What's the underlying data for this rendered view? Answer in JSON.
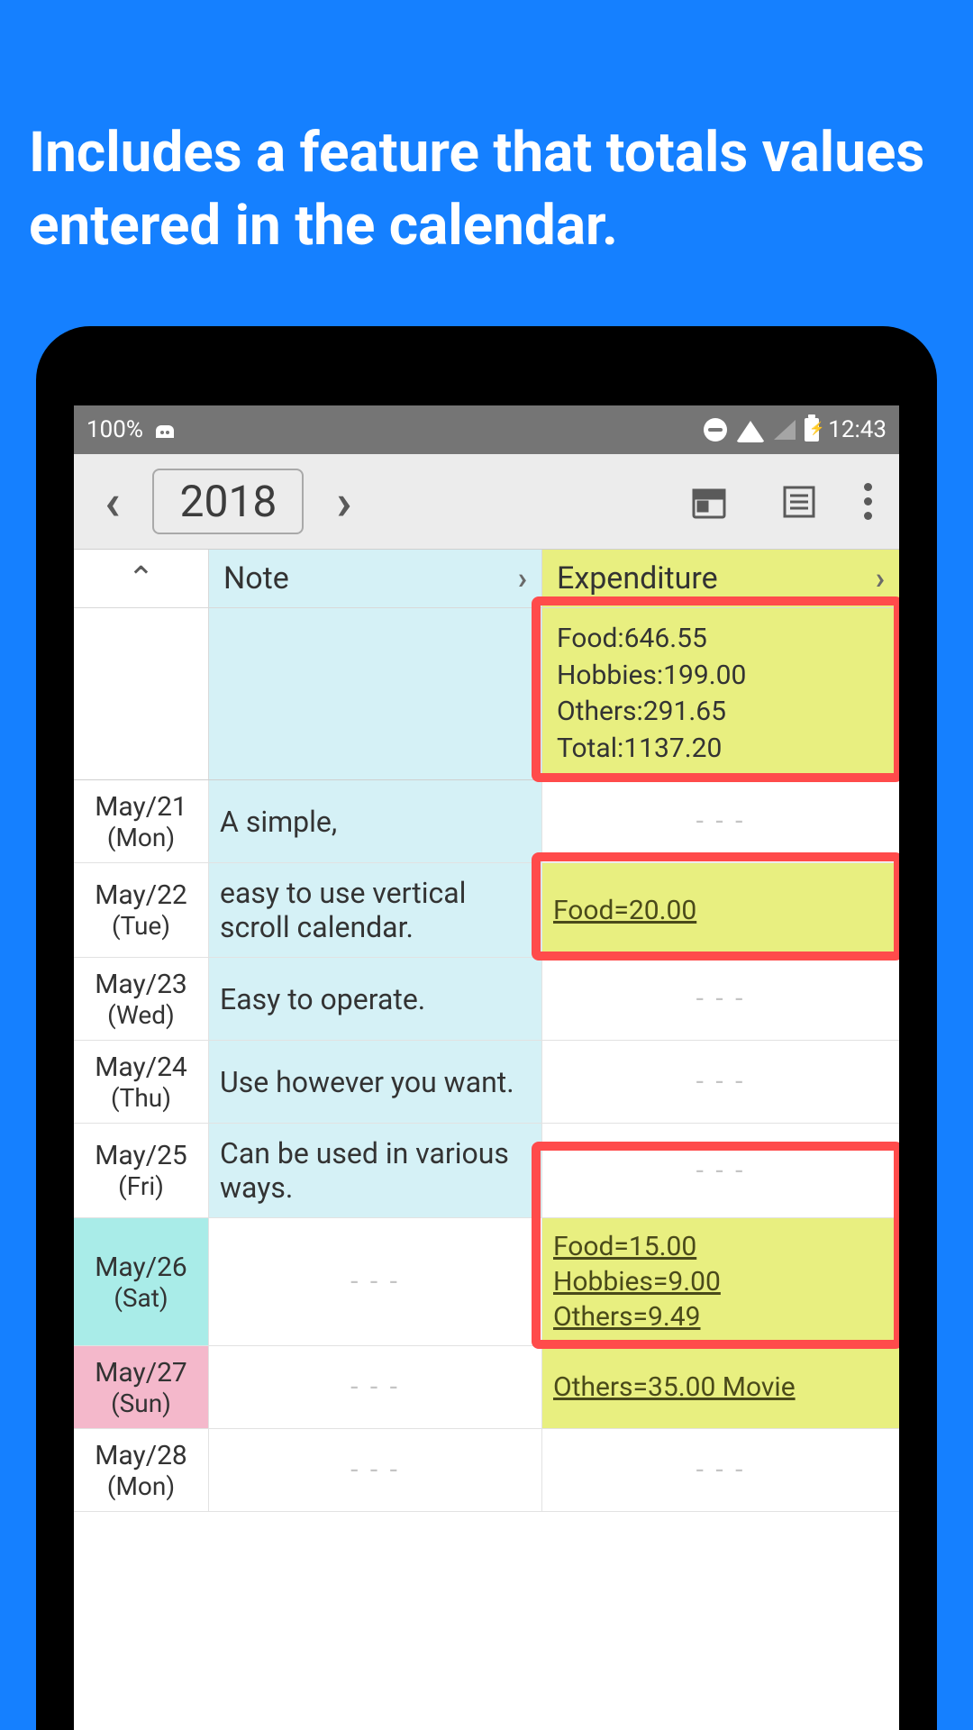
{
  "headline": "Includes a feature that totals values entered in the calendar.",
  "status_bar": {
    "battery_text": "100%",
    "clock": "12:43"
  },
  "toolbar": {
    "year": "2018"
  },
  "headers": {
    "note": "Note",
    "expenditure": "Expenditure"
  },
  "summary": {
    "lines": [
      "Food:646.55",
      "Hobbies:199.00",
      "Others:291.65",
      "Total:1137.20"
    ]
  },
  "placeholder": "- - -",
  "rows": [
    {
      "date": "May/21",
      "dow": "(Mon)",
      "note": "A simple,",
      "exp": null
    },
    {
      "date": "May/22",
      "dow": "(Tue)",
      "note": "easy to use vertical scroll calendar.",
      "exp": [
        "Food=20.00"
      ]
    },
    {
      "date": "May/23",
      "dow": "(Wed)",
      "note": "Easy to operate.",
      "exp": null
    },
    {
      "date": "May/24",
      "dow": "(Thu)",
      "note": "Use however you want.",
      "exp": null
    },
    {
      "date": "May/25",
      "dow": "(Fri)",
      "note": "Can be used in various ways.",
      "exp": null
    },
    {
      "date": "May/26",
      "dow": "(Sat)",
      "note": null,
      "exp": [
        "Food=15.00",
        "Hobbies=9.00",
        "Others=9.49"
      ],
      "dayStyle": "sat"
    },
    {
      "date": "May/27",
      "dow": "(Sun)",
      "note": null,
      "exp": [
        "Others=35.00 Movie"
      ],
      "dayStyle": "sun"
    },
    {
      "date": "May/28",
      "dow": "(Mon)",
      "note": null,
      "exp": null
    }
  ]
}
